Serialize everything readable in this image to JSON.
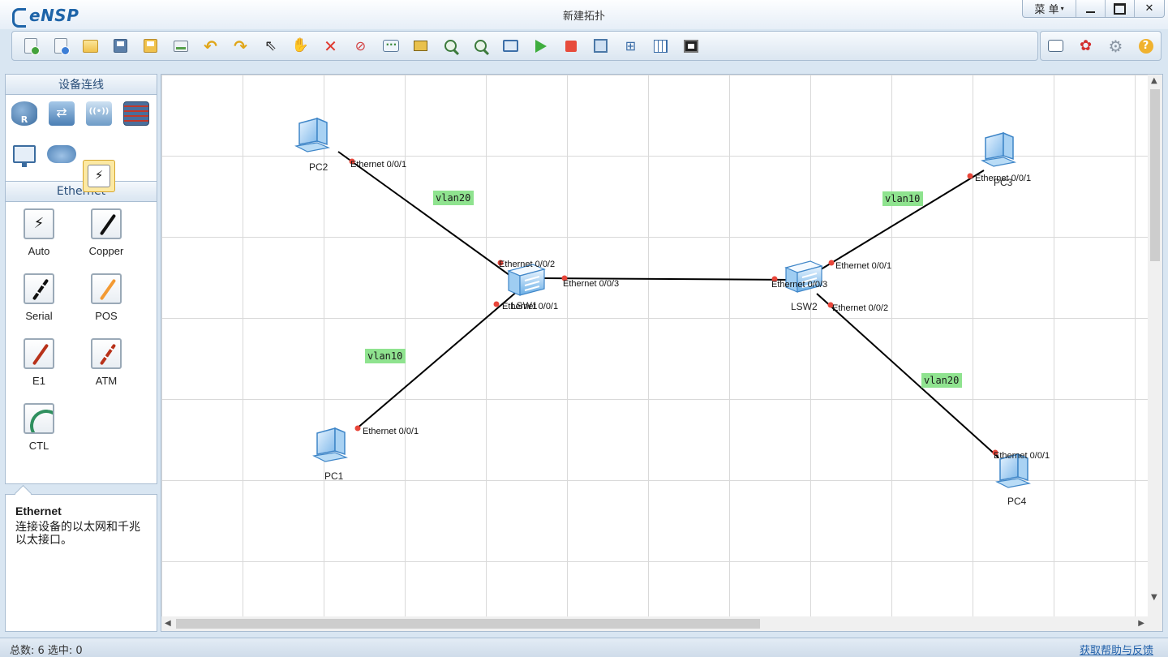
{
  "app": {
    "name": "eNSP",
    "window_title": "新建拓扑"
  },
  "window_controls": {
    "menu_label": "菜 单",
    "menu_arrow": "▾",
    "close_glyph": "✕"
  },
  "toolbar": {
    "buttons": [
      "new-topology",
      "new-lab",
      "open",
      "save",
      "save-as",
      "print",
      "undo",
      "redo",
      "select",
      "pan",
      "delete",
      "delete-links",
      "text",
      "rectangle",
      "zoom-in",
      "zoom-out",
      "fit-view",
      "start-devices",
      "stop-devices",
      "capture",
      "topology-tree",
      "grid",
      "command-line"
    ],
    "right_buttons": [
      "message",
      "huawei",
      "settings",
      "help"
    ]
  },
  "left_panel": {
    "device_header": "设备连线",
    "device_categories": [
      "router",
      "switch",
      "wlan",
      "firewall",
      "pc",
      "cloud",
      "connection"
    ],
    "selected_category": "connection",
    "connection_header": "Ethernet",
    "connections": [
      {
        "label": "Auto"
      },
      {
        "label": "Copper"
      },
      {
        "label": "Serial"
      },
      {
        "label": "POS"
      },
      {
        "label": "E1"
      },
      {
        "label": "ATM"
      },
      {
        "label": "CTL"
      }
    ],
    "description": {
      "title": "Ethernet",
      "text": "连接设备的以太网和千兆以太接口。"
    }
  },
  "topology": {
    "devices": {
      "pc1": "PC1",
      "pc2": "PC2",
      "pc3": "PC3",
      "pc4": "PC4",
      "lsw1": "LSW1",
      "lsw2": "LSW2"
    },
    "ports": {
      "pc2": "Ethernet 0/0/1",
      "lsw1_e2": "Ethernet 0/0/2",
      "lsw1_e3": "Ethernet 0/0/3",
      "lsw1_e1": "Ethernet 0/0/1",
      "pc1": "Ethernet 0/0/1",
      "lsw2_e3": "Ethernet 0/0/3",
      "lsw2_e1": "Ethernet 0/0/1",
      "lsw2_e2": "Ethernet 0/0/2",
      "pc3": "Ethernet 0/0/1",
      "pc4": "Ethernet 0/0/1"
    },
    "vlan_labels": {
      "pc2_link": "vlan20",
      "pc1_link": "vlan10",
      "pc3_link": "vlan10",
      "pc4_link": "vlan20"
    },
    "colors": {
      "link": "#000000",
      "port_dot": "#e8463a",
      "vlan_bg": "#8fe38f"
    }
  },
  "status": {
    "text": "总数: 6  选中: 0",
    "help_link": "获取帮助与反馈"
  }
}
